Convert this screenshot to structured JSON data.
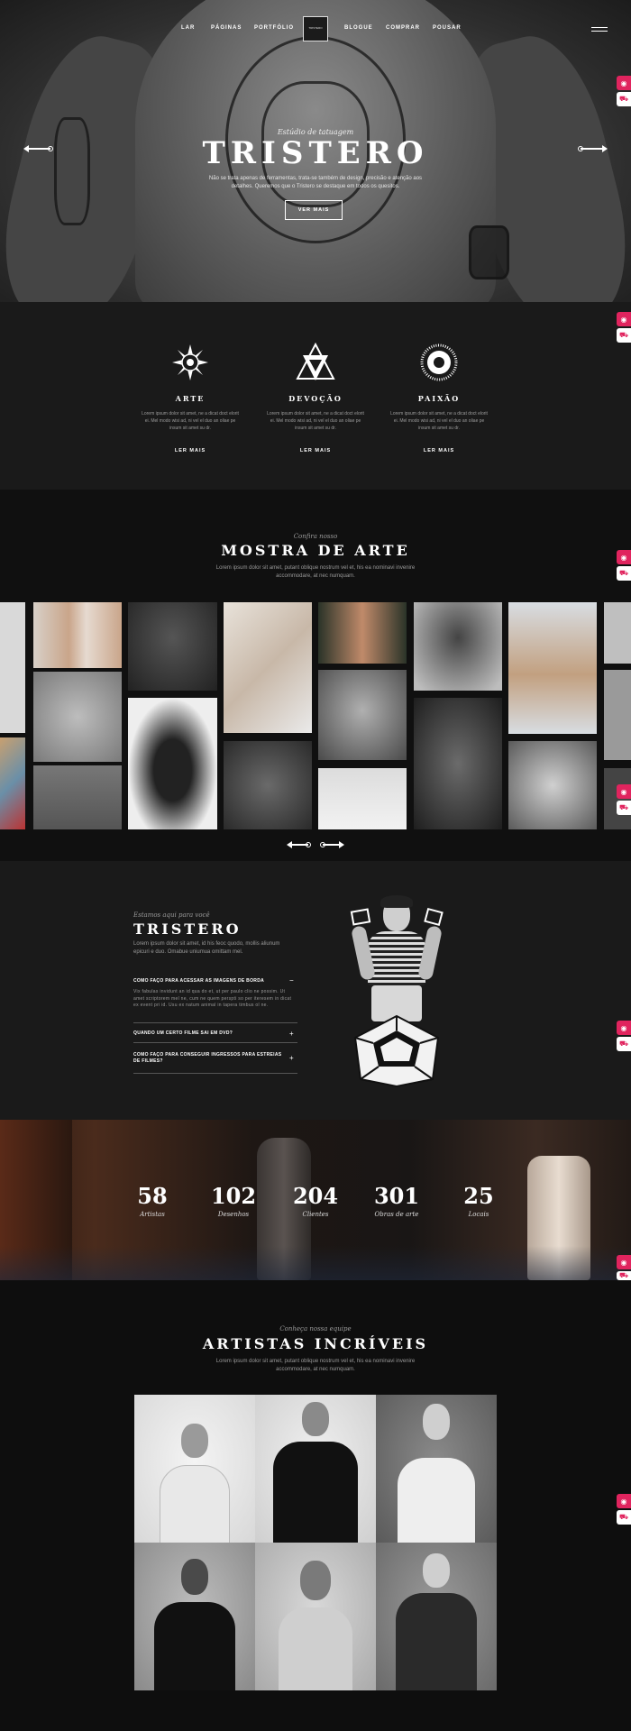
{
  "nav": {
    "left": [
      "LAR",
      "PÁGINAS",
      "PORTFÓLIO"
    ],
    "right": [
      "BLOGUE",
      "COMPRAR",
      "POUSAR"
    ],
    "logo_text": "TRISTERO"
  },
  "hero": {
    "eyebrow": "Estúdio de tatuagem",
    "title": "TRISTERO",
    "text": "Não se trata apenas de ferramentas, trata-se também de design, precisão e atenção aos detalhes. Queremos que o Tristero se destaque em todos os quesitos.",
    "button": "VER MAIS"
  },
  "features": [
    {
      "title": "ARTE",
      "text": "Lorem ipsum dolor sit amet, ne a dicat doct elorit ei. Mel modo wisi ad, ni vel el duo an oliae pe insum sit amet su dr.",
      "link": "LER MAIS"
    },
    {
      "title": "DEVOÇÃO",
      "text": "Lorem ipsum dolor sit amet, ne a dicat doct elorit ei. Mel modo wisi ad, ni vel el duo an oliae pe insum sit amet su dr.",
      "link": "LER MAIS"
    },
    {
      "title": "PAIXÃO",
      "text": "Lorem ipsum dolor sit amet, ne a dicat doct elorit ei. Mel modo wisi ad, ni vel el duo an oliae pe insum sit amet su dr.",
      "link": "LER MAIS"
    }
  ],
  "showcase": {
    "eyebrow": "Confira nosso",
    "title": "MOSTRA DE ARTE",
    "text": "Lorem ipsum dolor sit amet, putant oblique nostrum vel et, his ea nominavi invenire accommodare, at nec numquam."
  },
  "faq": {
    "eyebrow": "Estamos aqui para você",
    "title": "TRISTERO",
    "intro": "Lorem ipsum dolor sit amet, id his feoc quodo, mollis aliunum epicuri e duo. Omabue uniumua omittam mel.",
    "items": [
      {
        "q": "COMO FAÇO PARA ACESSAR AS IMAGENS DE BORDA",
        "sign": "−",
        "a": "Vix fabulas invidunt an id qua do et, ut per paulo clio ne possim. Ut amet scriptorem mel ne, cum ne quem perspti so per iteresem in dicat ex event pri id. Usu ex natum animal in tapera timbus ol ne."
      },
      {
        "q": "QUANDO UM CERTO FILME SAI EM DVD?",
        "sign": "+",
        "a": ""
      },
      {
        "q": "COMO FAÇO PARA CONSEGUIR INGRESSOS PARA ESTREIAS DE FILMES?",
        "sign": "+",
        "a": ""
      }
    ]
  },
  "stats": [
    {
      "n": "58",
      "l": "Artistas"
    },
    {
      "n": "102",
      "l": "Desenhos"
    },
    {
      "n": "204",
      "l": "Clientes"
    },
    {
      "n": "301",
      "l": "Obras de arte"
    },
    {
      "n": "25",
      "l": "Locais"
    }
  ],
  "artists": {
    "eyebrow": "Conheça nossa equipe",
    "title": "ARTISTAS INCRÍVEIS",
    "text": "Lorem ipsum dolor sit amet, putant oblique nostrum vel et, his ea nominavi invenire accommodare, at nec numquam."
  },
  "icons": [
    "prev-arrow-icon",
    "next-arrow-icon",
    "hamburger-icon",
    "lifebuoy-icon",
    "cart-icon",
    "mandala-icon",
    "triangle-eye-icon",
    "sun-icon"
  ],
  "colors": {
    "accent": "#e0245e",
    "background": "#0d0d0d",
    "panel": "#1a1a1a"
  }
}
